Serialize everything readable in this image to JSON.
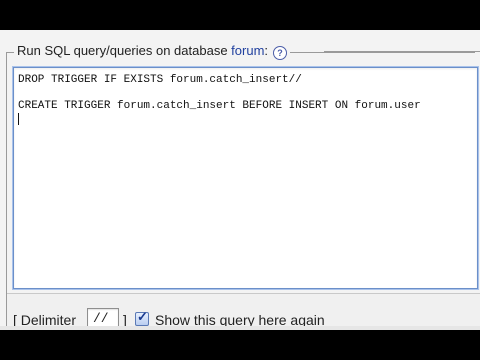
{
  "legend": {
    "prefix": "Run SQL query/queries on database ",
    "database": "forum",
    "suffix": ":",
    "help_glyph": "?"
  },
  "editor": {
    "lines": [
      "DROP TRIGGER IF EXISTS forum.catch_insert//",
      "",
      "CREATE TRIGGER forum.catch_insert BEFORE INSERT ON forum.user"
    ]
  },
  "options": {
    "open_bracket": "[ Delimiter",
    "delimiter_value": "//",
    "close_bracket": "]",
    "show_again_checked": true,
    "show_again_label": "Show this query here again"
  },
  "colors": {
    "database_link": "#1f3f9e",
    "editor_focus": "#6b8fc9"
  }
}
